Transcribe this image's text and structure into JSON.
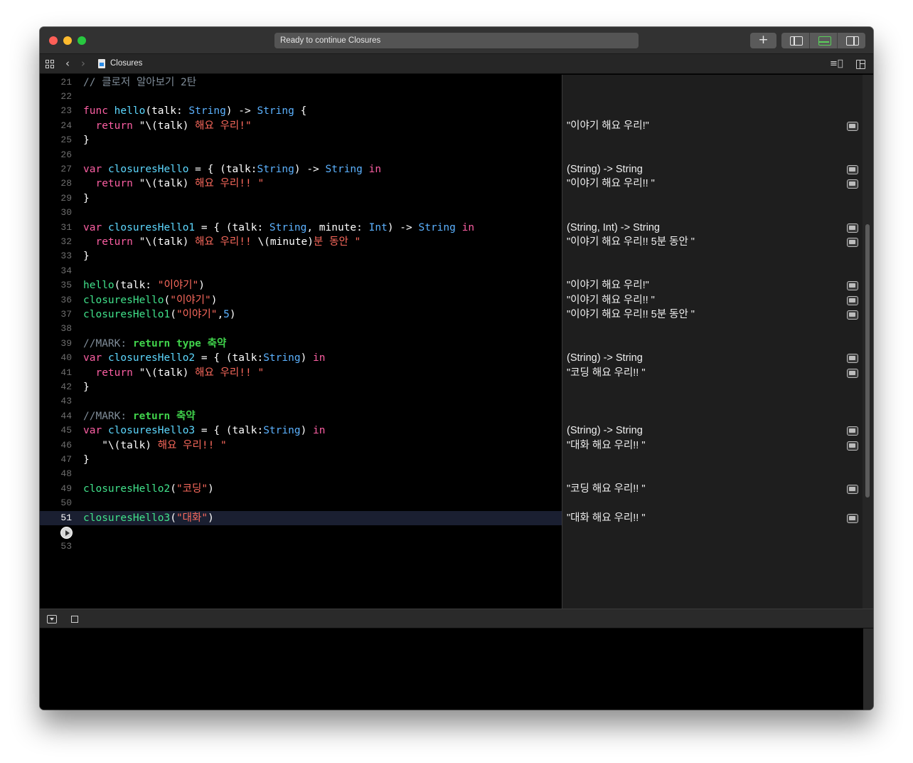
{
  "window": {
    "activity_text": "Ready to continue Closures",
    "add_button": "+"
  },
  "jumpbar": {
    "file_name": "Closures",
    "back": "‹",
    "forward": "›",
    "lines_icon": "≡⃞"
  },
  "colors": {
    "keyword": "#fc5fa3",
    "type": "#5cb2ff",
    "string": "#fc6a5d",
    "comment": "#7f8c98",
    "mark": "#40d24b",
    "function_call": "#41e28b",
    "current_line": "#1a1f31"
  },
  "editor": {
    "current_line": 51,
    "run_button_line": 52,
    "lines": [
      {
        "n": "21",
        "tokens": [
          {
            "t": "// 클로저 알아보기 2탄",
            "c": "cmt"
          }
        ]
      },
      {
        "n": "22",
        "tokens": []
      },
      {
        "n": "23",
        "tokens": [
          {
            "t": "func",
            "c": "kw"
          },
          {
            "t": " "
          },
          {
            "t": "hello",
            "c": "decl"
          },
          {
            "t": "(talk: "
          },
          {
            "t": "String",
            "c": "ty"
          },
          {
            "t": ") -> "
          },
          {
            "t": "String",
            "c": "ty"
          },
          {
            "t": " {"
          }
        ]
      },
      {
        "n": "24",
        "tokens": [
          {
            "t": "  "
          },
          {
            "t": "return",
            "c": "kw"
          },
          {
            "t": " \"\\(talk) ",
            "c": ""
          },
          {
            "t": "해요 우리!",
            "c": "str"
          },
          {
            "t": "\"",
            "c": "str"
          }
        ]
      },
      {
        "n": "25",
        "tokens": [
          {
            "t": "}"
          }
        ]
      },
      {
        "n": "26",
        "tokens": []
      },
      {
        "n": "27",
        "tokens": [
          {
            "t": "var",
            "c": "kw"
          },
          {
            "t": " "
          },
          {
            "t": "closuresHello",
            "c": "decl"
          },
          {
            "t": " = { (talk:"
          },
          {
            "t": "String",
            "c": "ty"
          },
          {
            "t": ") -> "
          },
          {
            "t": "String",
            "c": "ty"
          },
          {
            "t": " "
          },
          {
            "t": "in",
            "c": "kw"
          }
        ]
      },
      {
        "n": "28",
        "tokens": [
          {
            "t": "  "
          },
          {
            "t": "return",
            "c": "kw"
          },
          {
            "t": " \"\\(talk) "
          },
          {
            "t": "해요 우리!! \"",
            "c": "str"
          }
        ]
      },
      {
        "n": "29",
        "tokens": [
          {
            "t": "}"
          }
        ]
      },
      {
        "n": "30",
        "tokens": []
      },
      {
        "n": "31",
        "tokens": [
          {
            "t": "var",
            "c": "kw"
          },
          {
            "t": " "
          },
          {
            "t": "closuresHello1",
            "c": "decl"
          },
          {
            "t": " = { (talk: "
          },
          {
            "t": "String",
            "c": "ty"
          },
          {
            "t": ", minute: "
          },
          {
            "t": "Int",
            "c": "ty"
          },
          {
            "t": ") -> "
          },
          {
            "t": "String",
            "c": "ty"
          },
          {
            "t": " "
          },
          {
            "t": "in",
            "c": "kw"
          }
        ]
      },
      {
        "n": "32",
        "tokens": [
          {
            "t": "  "
          },
          {
            "t": "return",
            "c": "kw"
          },
          {
            "t": " \"\\(talk) "
          },
          {
            "t": "해요 우리!! ",
            "c": "str"
          },
          {
            "t": "\\(minute)"
          },
          {
            "t": "분 동안 \"",
            "c": "str"
          }
        ]
      },
      {
        "n": "33",
        "tokens": [
          {
            "t": "}"
          }
        ]
      },
      {
        "n": "34",
        "tokens": []
      },
      {
        "n": "35",
        "tokens": [
          {
            "t": "hello",
            "c": "call"
          },
          {
            "t": "(talk: "
          },
          {
            "t": "\"이야기\"",
            "c": "str"
          },
          {
            "t": ")"
          }
        ]
      },
      {
        "n": "36",
        "tokens": [
          {
            "t": "closuresHello",
            "c": "call"
          },
          {
            "t": "("
          },
          {
            "t": "\"이야기\"",
            "c": "str"
          },
          {
            "t": ")"
          }
        ]
      },
      {
        "n": "37",
        "tokens": [
          {
            "t": "closuresHello1",
            "c": "call"
          },
          {
            "t": "("
          },
          {
            "t": "\"이야기\"",
            "c": "str"
          },
          {
            "t": ","
          },
          {
            "t": "5",
            "c": "ty"
          },
          {
            "t": ")"
          }
        ]
      },
      {
        "n": "38",
        "tokens": []
      },
      {
        "n": "39",
        "tokens": [
          {
            "t": "//MARK: ",
            "c": "cmt"
          },
          {
            "t": "return type 축약",
            "c": "mark"
          }
        ]
      },
      {
        "n": "40",
        "tokens": [
          {
            "t": "var",
            "c": "kw"
          },
          {
            "t": " "
          },
          {
            "t": "closuresHello2",
            "c": "decl"
          },
          {
            "t": " = { (talk:"
          },
          {
            "t": "String",
            "c": "ty"
          },
          {
            "t": ") "
          },
          {
            "t": "in",
            "c": "kw"
          }
        ]
      },
      {
        "n": "41",
        "tokens": [
          {
            "t": "  "
          },
          {
            "t": "return",
            "c": "kw"
          },
          {
            "t": " \"\\(talk) "
          },
          {
            "t": "해요 우리!! \"",
            "c": "str"
          }
        ]
      },
      {
        "n": "42",
        "tokens": [
          {
            "t": "}"
          }
        ]
      },
      {
        "n": "43",
        "tokens": []
      },
      {
        "n": "44",
        "tokens": [
          {
            "t": "//MARK: ",
            "c": "cmt"
          },
          {
            "t": "return 축약",
            "c": "mark"
          }
        ]
      },
      {
        "n": "45",
        "tokens": [
          {
            "t": "var",
            "c": "kw"
          },
          {
            "t": " "
          },
          {
            "t": "closuresHello3",
            "c": "decl"
          },
          {
            "t": " = { (talk:"
          },
          {
            "t": "String",
            "c": "ty"
          },
          {
            "t": ") "
          },
          {
            "t": "in",
            "c": "kw"
          }
        ]
      },
      {
        "n": "46",
        "tokens": [
          {
            "t": "   \"\\(talk) "
          },
          {
            "t": "해요 우리!! \"",
            "c": "str"
          }
        ]
      },
      {
        "n": "47",
        "tokens": [
          {
            "t": "}"
          }
        ]
      },
      {
        "n": "48",
        "tokens": []
      },
      {
        "n": "49",
        "tokens": [
          {
            "t": "closuresHello2",
            "c": "call"
          },
          {
            "t": "("
          },
          {
            "t": "\"코딩\"",
            "c": "str"
          },
          {
            "t": ")"
          }
        ]
      },
      {
        "n": "50",
        "tokens": []
      },
      {
        "n": "51",
        "tokens": [
          {
            "t": "closuresHello3",
            "c": "call"
          },
          {
            "t": "("
          },
          {
            "t": "\"대화\"",
            "c": "str"
          },
          {
            "t": ")"
          }
        ]
      },
      {
        "n": "",
        "tokens": []
      },
      {
        "n": "53",
        "tokens": []
      }
    ]
  },
  "results": [
    {
      "line": 24,
      "text": "\"이야기 해요 우리!\""
    },
    {
      "line": 27,
      "text": "(String) -> String"
    },
    {
      "line": 28,
      "text": "\"이야기 해요 우리!! \""
    },
    {
      "line": 31,
      "text": "(String, Int) -> String"
    },
    {
      "line": 32,
      "text": "\"이야기 해요 우리!! 5분 동안 \""
    },
    {
      "line": 35,
      "text": "\"이야기 해요 우리!\""
    },
    {
      "line": 36,
      "text": "\"이야기 해요 우리!! \""
    },
    {
      "line": 37,
      "text": "\"이야기 해요 우리!! 5분 동안 \""
    },
    {
      "line": 40,
      "text": "(String) -> String"
    },
    {
      "line": 41,
      "text": "\"코딩 해요 우리!! \""
    },
    {
      "line": 45,
      "text": "(String) -> String"
    },
    {
      "line": 46,
      "text": "\"대화 해요 우리!! \""
    },
    {
      "line": 49,
      "text": "\"코딩 해요 우리!! \""
    },
    {
      "line": 51,
      "text": "\"대화 해요 우리!! \""
    }
  ]
}
